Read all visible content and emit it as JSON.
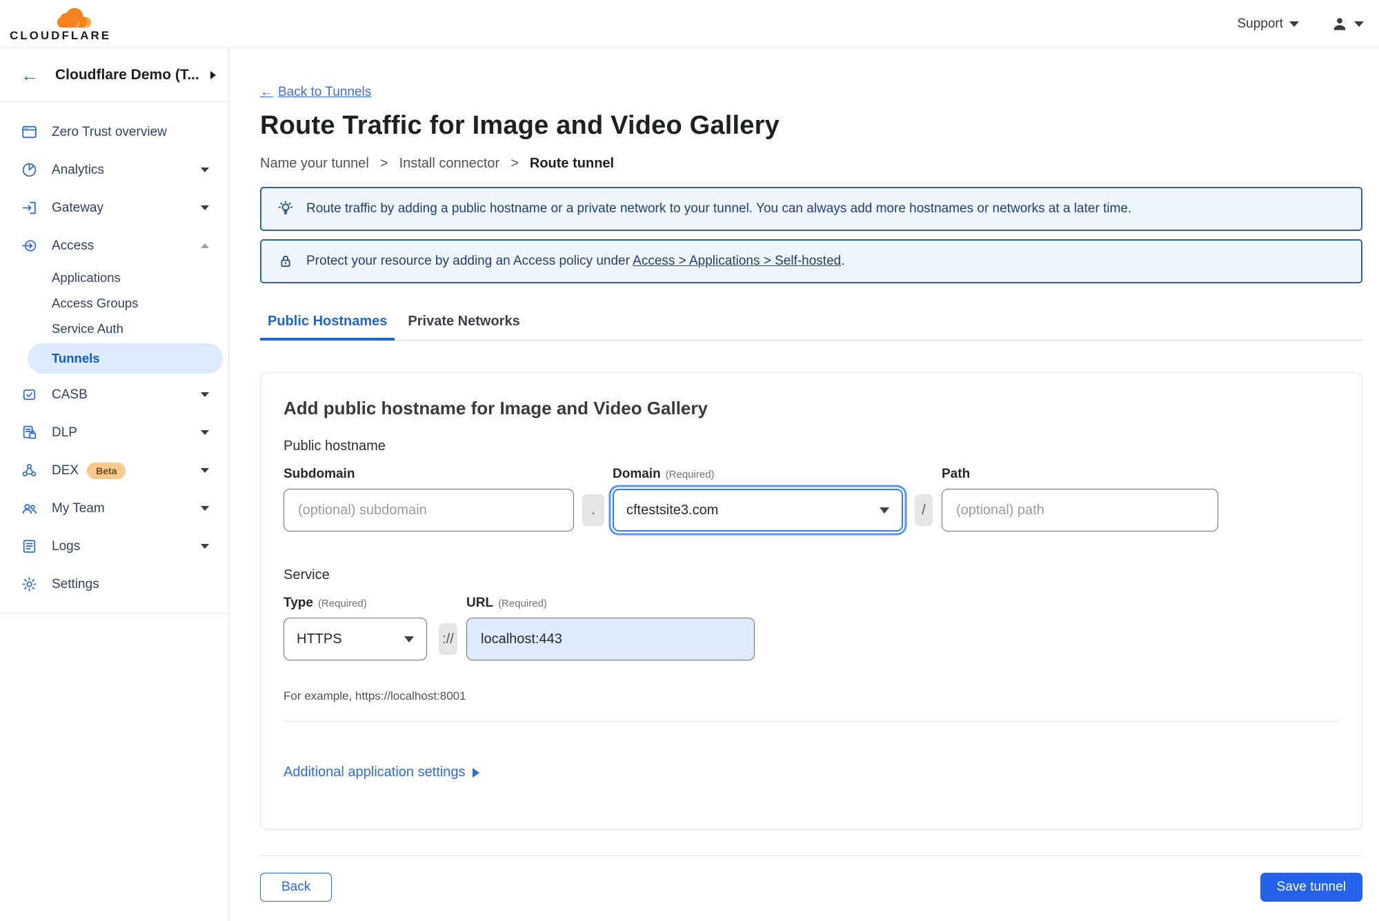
{
  "topbar": {
    "brand": "CLOUDFLARE",
    "support_label": "Support"
  },
  "sidebar": {
    "account_name": "Cloudflare Demo (T...",
    "items": [
      {
        "label": "Zero Trust overview",
        "icon": "window-icon"
      },
      {
        "label": "Analytics",
        "icon": "pie-chart-icon",
        "caret": "down"
      },
      {
        "label": "Gateway",
        "icon": "gateway-icon",
        "caret": "down"
      },
      {
        "label": "Access",
        "icon": "access-icon",
        "caret": "up"
      },
      {
        "label": "CASB",
        "icon": "casb-icon",
        "caret": "down"
      },
      {
        "label": "DLP",
        "icon": "dlp-icon",
        "caret": "down"
      },
      {
        "label": "DEX",
        "icon": "dex-icon",
        "badge": "Beta",
        "caret": "down"
      },
      {
        "label": "My Team",
        "icon": "team-icon",
        "caret": "down"
      },
      {
        "label": "Logs",
        "icon": "logs-icon",
        "caret": "down"
      },
      {
        "label": "Settings",
        "icon": "gear-icon"
      }
    ],
    "access_children": [
      {
        "label": "Applications",
        "active": false
      },
      {
        "label": "Access Groups",
        "active": false
      },
      {
        "label": "Service Auth",
        "active": false
      },
      {
        "label": "Tunnels",
        "active": true
      }
    ]
  },
  "main": {
    "back_arrow": "←",
    "back_label": "Back to Tunnels",
    "title": "Route Traffic for Image and Video Gallery",
    "step_separator": ">",
    "steps": [
      {
        "label": "Name your tunnel",
        "current": false
      },
      {
        "label": "Install connector",
        "current": false
      },
      {
        "label": "Route tunnel",
        "current": true
      }
    ],
    "banners": [
      {
        "icon": "lightbulb-icon",
        "text": "Route traffic by adding a public hostname or a private network to your tunnel. You can always add more hostnames or networks at a later time."
      },
      {
        "icon": "lock-icon",
        "text_before": "Protect your resource by adding an Access policy under ",
        "link_text": "Access > Applications > Self-hosted",
        "text_after": "."
      }
    ],
    "tabs": [
      {
        "label": "Public Hostnames",
        "active": true
      },
      {
        "label": "Private Networks",
        "active": false
      }
    ],
    "card": {
      "heading": "Add public hostname for Image and Video Gallery",
      "section_label": "Public hostname",
      "subdomain": {
        "label": "Subdomain",
        "placeholder": "(optional) subdomain"
      },
      "dot_separator": ".",
      "domain": {
        "label": "Domain",
        "required": "(Required)",
        "value": "cftestsite3.com"
      },
      "slash_separator": "/",
      "path": {
        "label": "Path",
        "placeholder": "(optional) path"
      },
      "service_label": "Service",
      "type": {
        "label": "Type",
        "required": "(Required)",
        "value": "HTTPS"
      },
      "scheme_separator": "://",
      "url": {
        "label": "URL",
        "required": "(Required)",
        "value": "localhost:443"
      },
      "example": "For example, https://localhost:8001",
      "additional_settings_label": "Additional application settings"
    },
    "footer": {
      "back_label": "Back",
      "save_label": "Save tunnel"
    }
  },
  "colors": {
    "accent_blue": "#2462eb",
    "link_blue": "#2f6ae0",
    "active_tab_blue": "#1a66d9",
    "sidebar_icon_blue": "#2e6bd6",
    "active_pill_bg": "#dceafd",
    "active_pill_text": "#0b5cd5",
    "banner_bg": "#eef5fd",
    "banner_border": "#3060aa",
    "banner_text": "#233e73",
    "beta_badge_bg": "#f9c98c",
    "url_field_bg": "#dfeafd",
    "logo_orange": "#f6821f",
    "logo_light_orange": "#fbad41"
  }
}
